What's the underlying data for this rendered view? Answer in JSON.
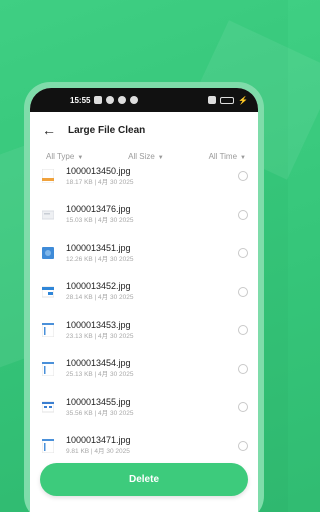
{
  "status": {
    "time": "15:55"
  },
  "header": {
    "title": "Large File Clean"
  },
  "filters": [
    {
      "label": "All Type"
    },
    {
      "label": "All Size"
    },
    {
      "label": "All Time"
    }
  ],
  "files": [
    {
      "name": "1000013450.jpg",
      "meta": "18.17 KB | 4月 30 2025",
      "thumb_color": "#f0a23c"
    },
    {
      "name": "1000013476.jpg",
      "meta": "15.03 KB | 4月 30 2025",
      "thumb_color": "#d9dde3"
    },
    {
      "name": "1000013451.jpg",
      "meta": "12.26 KB | 4月 30 2025",
      "thumb_color": "#3f8bd8"
    },
    {
      "name": "1000013452.jpg",
      "meta": "28.14 KB | 4月 30 2025",
      "thumb_color": "#2f86d8"
    },
    {
      "name": "1000013453.jpg",
      "meta": "23.13 KB | 4月 30 2025",
      "thumb_color": "#4a90d9"
    },
    {
      "name": "1000013454.jpg",
      "meta": "25.13 KB | 4月 30 2025",
      "thumb_color": "#4a90d9"
    },
    {
      "name": "1000013455.jpg",
      "meta": "35.56 KB | 4月 30 2025",
      "thumb_color": "#3b7fd1"
    },
    {
      "name": "1000013471.jpg",
      "meta": "9.81 KB | 4月 30 2025",
      "thumb_color": "#4a90d9"
    }
  ],
  "actions": {
    "delete_label": "Delete"
  }
}
